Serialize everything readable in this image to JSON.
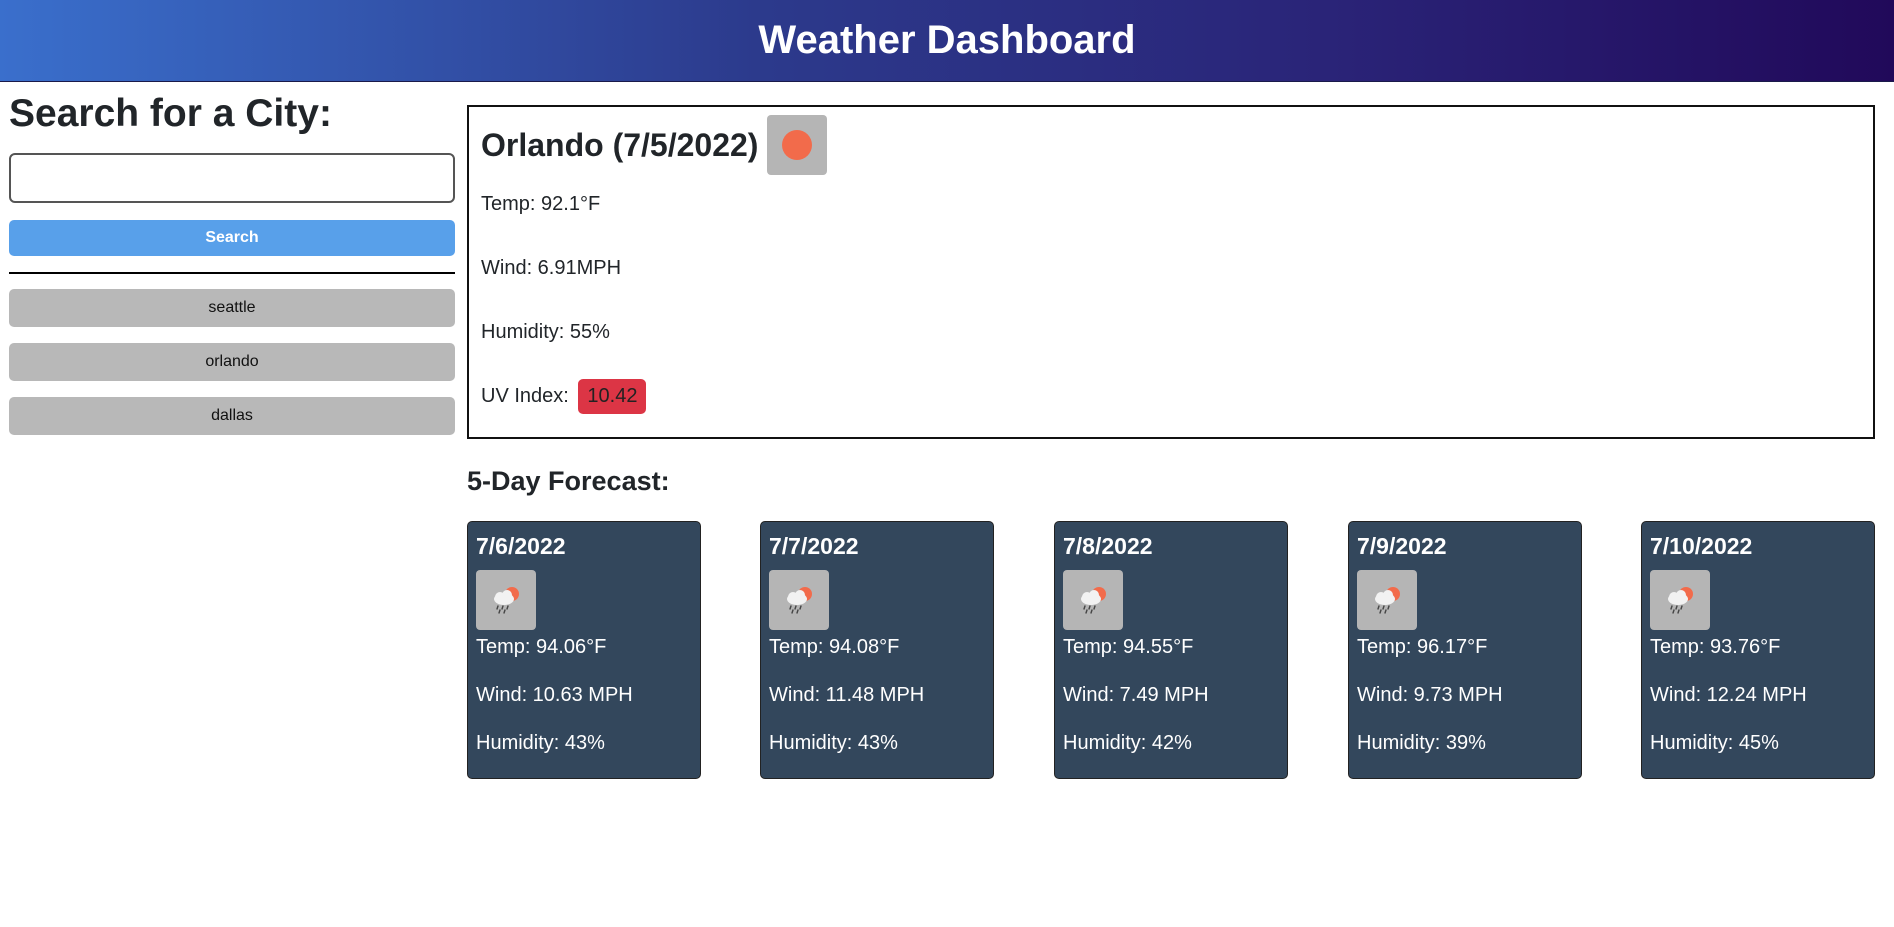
{
  "header": {
    "title": "Weather Dashboard"
  },
  "search": {
    "heading": "Search for a City:",
    "input_value": "",
    "button_label": "Search",
    "history": [
      "seattle",
      "orlando",
      "dallas"
    ]
  },
  "current": {
    "title": "Orlando (7/5/2022)",
    "icon": "sun-icon",
    "temp": "Temp: 92.1°F",
    "wind": "Wind: 6.91MPH",
    "humidity": "Humidity: 55%",
    "uv_label": "UV Index:",
    "uv_value": "10.42",
    "uv_color": "#dc3545"
  },
  "forecast": {
    "heading": "5-Day Forecast:",
    "days": [
      {
        "date": "7/6/2022",
        "icon": "rain-cloud-sun-icon",
        "temp": "Temp: 94.06°F",
        "wind": "Wind: 10.63 MPH",
        "humidity": "Humidity: 43%"
      },
      {
        "date": "7/7/2022",
        "icon": "rain-cloud-sun-icon",
        "temp": "Temp: 94.08°F",
        "wind": "Wind: 11.48 MPH",
        "humidity": "Humidity: 43%"
      },
      {
        "date": "7/8/2022",
        "icon": "rain-cloud-sun-icon",
        "temp": "Temp: 94.55°F",
        "wind": "Wind: 7.49 MPH",
        "humidity": "Humidity: 42%"
      },
      {
        "date": "7/9/2022",
        "icon": "rain-cloud-sun-icon",
        "temp": "Temp: 96.17°F",
        "wind": "Wind: 9.73 MPH",
        "humidity": "Humidity: 39%"
      },
      {
        "date": "7/10/2022",
        "icon": "rain-cloud-sun-icon",
        "temp": "Temp: 93.76°F",
        "wind": "Wind: 12.24 MPH",
        "humidity": "Humidity: 45%"
      }
    ]
  },
  "colors": {
    "search_button": "#58a0ea",
    "history_button": "#b8b8b8",
    "card_background": "#33475c",
    "sun": "#f26b4b"
  }
}
